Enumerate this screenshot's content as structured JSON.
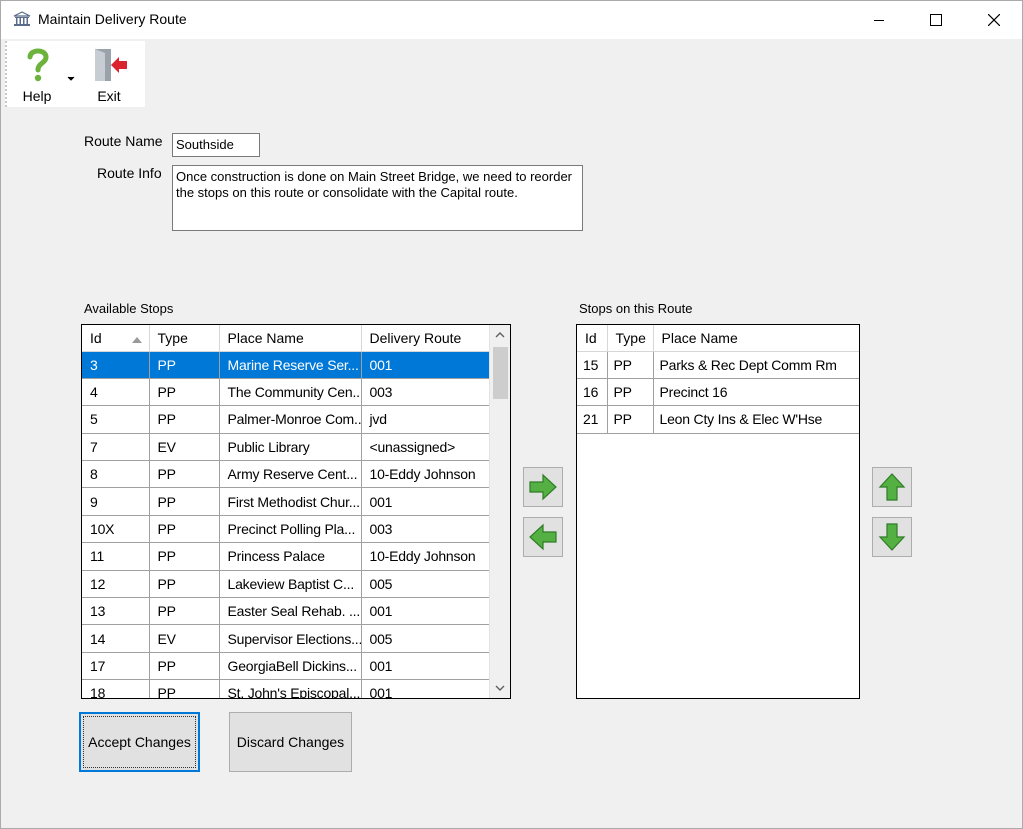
{
  "window": {
    "title": "Maintain Delivery Route",
    "icon": "bank-building-icon"
  },
  "toolbar": {
    "help_label": "Help",
    "help_icon": "question-mark-icon",
    "exit_label": "Exit",
    "exit_icon": "exit-door-icon"
  },
  "form": {
    "route_name_label": "Route Name",
    "route_name_value": "Southside",
    "route_info_label": "Route Info",
    "route_info_value": "Once construction is done on Main Street Bridge, we need to reorder the stops on this route or consolidate with the Capital route."
  },
  "available": {
    "label": "Available Stops",
    "columns": [
      "Id",
      "Type",
      "Place Name",
      "Delivery Route"
    ],
    "sort_column": "Id",
    "rows": [
      {
        "id": "3",
        "type": "PP",
        "place": "Marine Reserve Ser...",
        "route": "001",
        "selected": true
      },
      {
        "id": "4",
        "type": "PP",
        "place": "The Community Cen...",
        "route": "003"
      },
      {
        "id": "5",
        "type": "PP",
        "place": "Palmer-Monroe Com...",
        "route": "jvd"
      },
      {
        "id": "7",
        "type": "EV",
        "place": "Public Library",
        "route": "<unassigned>"
      },
      {
        "id": "8",
        "type": "PP",
        "place": "Army Reserve Cent...",
        "route": "10-Eddy Johnson"
      },
      {
        "id": "9",
        "type": "PP",
        "place": "First Methodist Chur...",
        "route": "001"
      },
      {
        "id": "10X",
        "type": "PP",
        "place": "Precinct Polling Pla...",
        "route": "003"
      },
      {
        "id": "11",
        "type": "PP",
        "place": "Princess Palace",
        "route": "10-Eddy Johnson"
      },
      {
        "id": "12",
        "type": "PP",
        "place": "Lakeview Baptist C...",
        "route": "005"
      },
      {
        "id": "13",
        "type": "PP",
        "place": "Easter Seal Rehab. ...",
        "route": "001"
      },
      {
        "id": "14",
        "type": "EV",
        "place": "Supervisor Elections...",
        "route": "005"
      },
      {
        "id": "17",
        "type": "PP",
        "place": "GeorgiaBell Dickins...",
        "route": "001"
      },
      {
        "id": "18",
        "type": "PP",
        "place": "St. John's Episcopal...",
        "route": "001"
      }
    ]
  },
  "onroute": {
    "label": "Stops on this Route",
    "columns": [
      "Id",
      "Type",
      "Place Name"
    ],
    "rows": [
      {
        "id": "15",
        "type": "PP",
        "place": "Parks & Rec Dept Comm Rm"
      },
      {
        "id": "16",
        "type": "PP",
        "place": "Precinct 16"
      },
      {
        "id": "21",
        "type": "PP",
        "place": "Leon Cty Ins & Elec W'Hse"
      }
    ]
  },
  "buttons": {
    "accept": "Accept Changes",
    "discard": "Discard Changes"
  },
  "colors": {
    "selection": "#0078d7",
    "arrow_green": "#3fa535"
  }
}
